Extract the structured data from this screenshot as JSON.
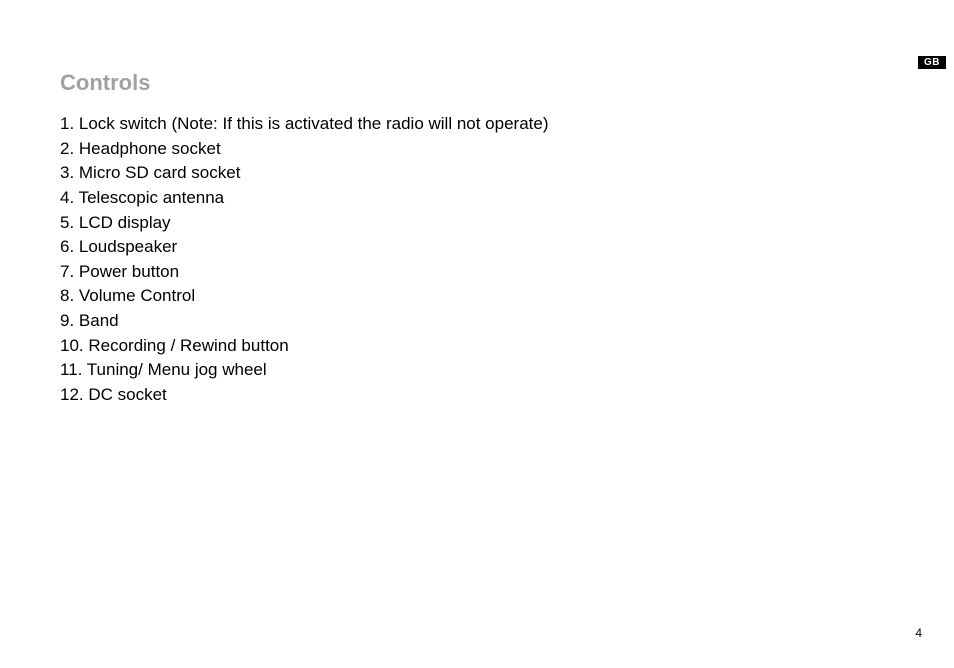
{
  "lang_tag": "GB",
  "title": "Controls",
  "items": [
    "1. Lock switch (Note: If this is activated the radio will not operate)",
    "2. Headphone socket",
    "3. Micro SD card socket",
    "4. Telescopic antenna",
    "5. LCD display",
    "6. Loudspeaker",
    "7. Power button",
    "8. Volume Control",
    "9. Band",
    "10. Recording / Rewind button",
    "11. Tuning/ Menu jog wheel",
    "12. DC socket"
  ],
  "page_number": "4"
}
